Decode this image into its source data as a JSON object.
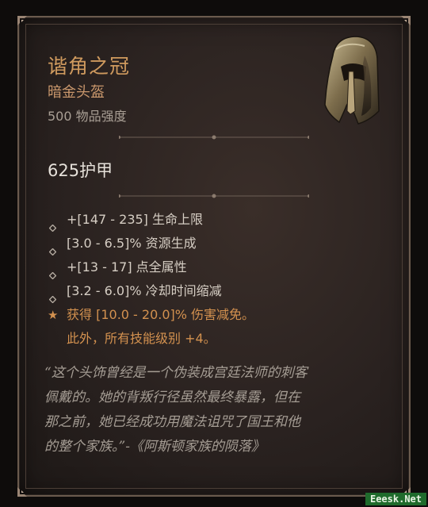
{
  "item": {
    "name": "谐角之冠",
    "type": "暗金头盔",
    "item_power": "500 物品强度",
    "armor": "625护甲"
  },
  "affixes": [
    {
      "text": "+[147 - 235] 生命上限",
      "kind": "normal"
    },
    {
      "text": "[3.0 - 6.5]% 资源生成",
      "kind": "normal"
    },
    {
      "text": "+[13 - 17] 点全属性",
      "kind": "normal"
    },
    {
      "text": "[3.2 - 6.0]% 冷却时间缩减",
      "kind": "normal"
    },
    {
      "text": "获得 [10.0 - 20.0]% 伤害减免。",
      "kind": "legendary"
    },
    {
      "text": "此外，所有技能级别 +4。",
      "kind": "legendary-continued"
    }
  ],
  "flavor": {
    "lines": [
      "“这个头饰曾经是一个伪装成宫廷法师的刺客",
      "佩戴的。她的背叛行径虽然最终暴露，但在",
      "那之前，她已经成功用魔法诅咒了国王和他",
      "的整个家族。”-《阿斯顿家族的陨落》"
    ]
  },
  "watermark": "Eeesk.Net",
  "colors": {
    "title": "#cf9a5e",
    "legendary": "#d3914f",
    "stat": "#d6cec4",
    "flavor": "#a59d94"
  },
  "icons": {
    "item_image": "helm-icon",
    "affix_bullet": "diamond-bullet-icon",
    "legendary_bullet": "star-icon"
  }
}
